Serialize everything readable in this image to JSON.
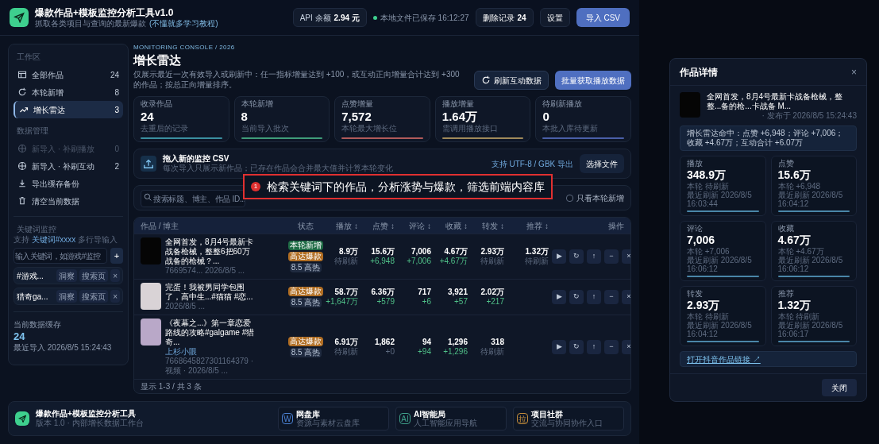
{
  "app": {
    "title": "爆款作品+模板监控分析工具v1.0",
    "subtitle": "抓取各类项目与查询的最新爆款",
    "subtitle_link": "(不懂就多学习教程)",
    "api_label": "API 余额",
    "api_value": "2.94 元",
    "save_status": "本地文件已保存 16:12:27",
    "deleted_label": "删除记录",
    "deleted_value": "24",
    "settings": "设置",
    "import": "导入 CSV"
  },
  "sidebar": {
    "sections": [
      {
        "title": "工作区",
        "items": [
          {
            "label": "全部作品",
            "count": "24",
            "selected": false,
            "disabled": false
          },
          {
            "label": "本轮新增",
            "count": "8",
            "selected": false,
            "disabled": false
          },
          {
            "label": "增长雷达",
            "count": "3",
            "selected": true,
            "disabled": false
          }
        ]
      },
      {
        "title": "数据管理",
        "items": [
          {
            "label": "新导入 · 补刷播放",
            "count": "0",
            "selected": false,
            "disabled": true
          },
          {
            "label": "新导入 · 补刷互动",
            "count": "2",
            "selected": false,
            "disabled": false
          },
          {
            "label": "导出缓存备份",
            "selected": false,
            "disabled": false
          },
          {
            "label": "清空当前数据",
            "selected": false,
            "disabled": false
          }
        ]
      }
    ],
    "keyword_title": "关键词监控",
    "keyword_hint": "支持",
    "keyword_hint_link": "关键词#xxxx",
    "keyword_hint_suffix": "多行导输入",
    "keyword_placeholder": "输入关键词，如游戏#监控",
    "add": "+",
    "keywords": [
      {
        "label": "#游戏...",
        "actions": [
          "洞察",
          "搜索页"
        ],
        "remove": "×"
      },
      {
        "label": "猎奇ga...",
        "actions": [
          "洞察",
          "搜索页"
        ],
        "remove": "×"
      }
    ],
    "cache_title": "当前数据缓存",
    "cache_count": "24",
    "cache_time": "最近导入 2026/8/5 15:24:43"
  },
  "main": {
    "eyebrow": "MONITORING CONSOLE / 2026",
    "title": "增长雷达",
    "description": "仅展示最近一次有效导入或刷新中：任一指标增量达到 +100，或互动正向增量合计达到 +300 的作品；按总正向增量排序。",
    "buttons": [
      "刷新互动数据",
      "批量获取播放数据"
    ],
    "stats": [
      {
        "label": "收录作品",
        "value": "24",
        "note": "去重后的记录",
        "color": "#3b8fa0"
      },
      {
        "label": "本轮新增",
        "value": "8",
        "note": "当前导入批次",
        "color": "#3f9d7a"
      },
      {
        "label": "点赞增量",
        "value": "7,572",
        "note": "本轮最大增长位",
        "color": "#b05a5a"
      },
      {
        "label": "播放增量",
        "value": "1.64万",
        "note": "需调用播放接口",
        "color": "#a08a5a"
      },
      {
        "label": "待刷新播放",
        "value": "0",
        "note": "本批入库待更新",
        "color": "#4a5fa8"
      }
    ],
    "upload": {
      "title": "拖入新的监控 CSV",
      "description": "每次导入只展示新作品；已存在作品会合并最大值并计算本轮变化",
      "hint": "支持 UTF-8 / GBK 导出",
      "button": "选择文件"
    },
    "search": {
      "placeholder": "搜索标题、博主、作品 ID...",
      "only_new": "只看本轮新增",
      "only_new_checked": false
    },
    "callout": {
      "number": "1",
      "text": "检索关键词下的作品，分析涨势与爆款，筛选前端内容库"
    },
    "table": {
      "columns": [
        "作品 / 博主",
        "状态",
        "播放 ↕",
        "点赞 ↕",
        "评论 ↕",
        "收藏 ↕",
        "转发 ↕",
        "推荐 ↕",
        "操作"
      ],
      "rows": [
        {
          "cells": [
            {
              "title": "全网首发，8月4号最新卡战备枪械，整整6把60万战备的枪械？...",
              "meta": "7669574... 2026/8/5 ..."
            },
            {
              "tags": [
                {
                  "label": "本轮新增",
                  "color": "#1f6b45"
                },
                {
                  "label": "高达爆款",
                  "color": "#b06d22"
                }
              ],
              "score": "8.5 高热"
            },
            {
              "value": "8.9万",
              "sub": "待刷新",
              "up": false
            },
            {
              "value": "15.6万",
              "sub": "+6,948",
              "up": true
            },
            {
              "value": "7,006",
              "sub": "+7,006",
              "up": true
            },
            {
              "value": "4.67万",
              "sub": "+4.67万",
              "up": true
            },
            {
              "value": "2.93万",
              "sub": "待刷新",
              "up": false
            },
            {
              "value": "1.32万",
              "sub": "待刷新",
              "up": false
            },
            {
              "actions": [
                "▶",
                "↻",
                "↑",
                "−",
                "×"
              ]
            }
          ]
        },
        {
          "cells": [
            {
              "title": "完蛋！我被男同学包围了，高中生...#猫猫 #恋...",
              "meta": "2026/8/5 ..."
            },
            {
              "tags": [
                {
                  "label": "高达爆款",
                  "color": "#b06d22"
                }
              ],
              "score": "8.5 高热"
            },
            {
              "value": "58.7万",
              "sub": "+1,647万",
              "up": true
            },
            {
              "value": "6.36万",
              "sub": "+579",
              "up": true
            },
            {
              "value": "717",
              "sub": "+6",
              "up": true
            },
            {
              "value": "3,921",
              "sub": "+57",
              "up": true
            },
            {
              "value": "2.02万",
              "sub": "+217",
              "up": true
            },
            "",
            {
              "actions": [
                "▶",
                "↻",
                "↑",
                "−",
                "×"
              ]
            }
          ]
        },
        {
          "cells": [
            {
              "title": "《夜幕之...》第一章恋爱路线的攻略#galgame #猎奇...",
              "author": "上杉小眼",
              "meta": "7668645827301164379 · 视频 · 2026/8/5 ..."
            },
            {
              "tags": [
                {
                  "label": "高达爆款",
                  "color": "#b06d22"
                }
              ],
              "score": "8.5 高热"
            },
            {
              "value": "6.91万",
              "sub": "待刷新",
              "up": false
            },
            {
              "value": "1,862",
              "sub": "+0",
              "up": false
            },
            {
              "value": "94",
              "sub": "+94",
              "up": true
            },
            {
              "value": "1,296",
              "sub": "+1,296",
              "up": true
            },
            {
              "value": "318",
              "sub": "待刷新",
              "up": false
            },
            "",
            {
              "actions": [
                "▶",
                "↻",
                "↑",
                "−",
                "×"
              ]
            }
          ]
        }
      ],
      "footer": "显示 1-3 / 共 3 条"
    }
  },
  "detail": {
    "title": "作品详情",
    "close_icon": "×",
    "work_title": "全网首发，8月4号最新卡战备枪械，整整...备的枪...卡战备 M...",
    "work_meta": "· 发布于 2026/8/5 15:24:43",
    "hit": "增长雷达命中：点赞 +6,948；评论 +7,006；收藏 +4.67万；互动合计 +6.07万",
    "metrics": [
      {
        "label": "播放",
        "value": "348.9万",
        "delta": "本轮 待刷新",
        "time": "最近刷新 2026/8/5 16:03:44"
      },
      {
        "label": "点赞",
        "value": "15.6万",
        "delta": "本轮 +6,948",
        "time": "最近刷新 2026/8/5 16:04:12"
      },
      {
        "label": "评论",
        "value": "7,006",
        "delta": "本轮 +7,006",
        "time": "最近刷新 2026/8/5 16:06:12"
      },
      {
        "label": "收藏",
        "value": "4.67万",
        "delta": "本轮 +4.67万",
        "time": "最近刷新 2026/8/5 16:06:12"
      },
      {
        "label": "转发",
        "value": "2.93万",
        "delta": "本轮 待刷新",
        "time": "最近刷新 2026/8/5 16:04:12"
      },
      {
        "label": "推荐",
        "value": "1.32万",
        "delta": "本轮 待刷新",
        "time": "最近刷新 2026/8/5 16:06:17"
      }
    ],
    "link": "打开抖音作品链接 ↗",
    "close": "关闭"
  },
  "footer": {
    "title": "爆款作品+模板监控分析工具",
    "subtitle": "版本 1.0 · 内部增长数据工作台",
    "cards": [
      {
        "badge": "W",
        "title": "网盘库",
        "subtitle": "资源与素材云盘库",
        "color": "#4a7fd0"
      },
      {
        "badge": "AI",
        "title": "AI智能局",
        "subtitle": "人工智能应用导航",
        "color": "#3fa08a"
      },
      {
        "badge": "拉",
        "title": "项目社群",
        "subtitle": "交流与协同协作入口",
        "color": "#c08a3a"
      }
    ]
  }
}
